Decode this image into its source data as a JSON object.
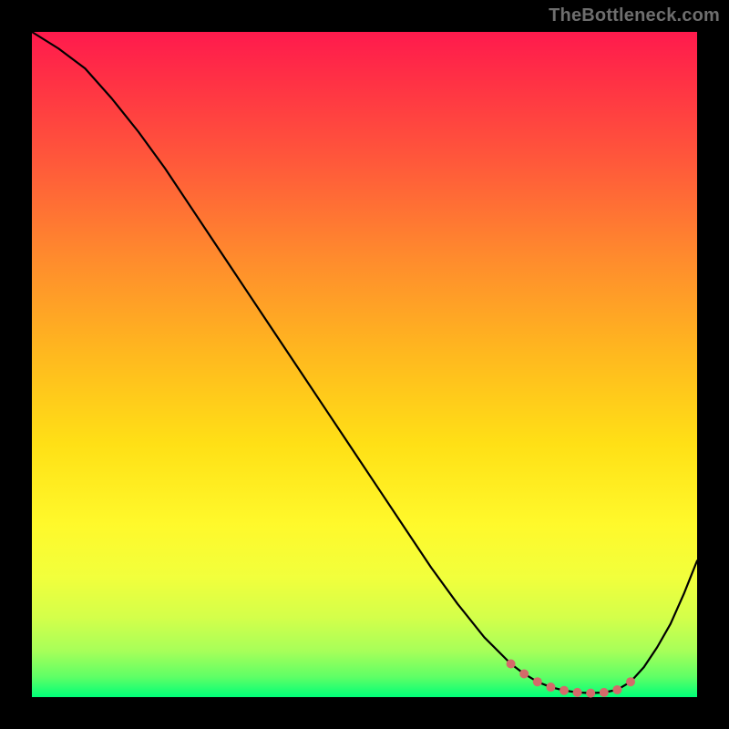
{
  "watermark": "TheBottleneck.com",
  "chart_data": {
    "type": "line",
    "title": "",
    "xlabel": "",
    "ylabel": "",
    "xlim": [
      0,
      100
    ],
    "ylim": [
      0,
      100
    ],
    "series": [
      {
        "name": "bottleneck-curve",
        "x": [
          0,
          4,
          8,
          12,
          16,
          20,
          24,
          28,
          32,
          36,
          40,
          44,
          48,
          52,
          56,
          60,
          64,
          68,
          72,
          74,
          76,
          78,
          80,
          82,
          84,
          86,
          88,
          90,
          92,
          94,
          96,
          98,
          100
        ],
        "y": [
          100,
          97.5,
          94.5,
          90.0,
          85.0,
          79.5,
          73.5,
          67.5,
          61.5,
          55.5,
          49.5,
          43.5,
          37.5,
          31.5,
          25.5,
          19.5,
          14.0,
          9.0,
          5.0,
          3.5,
          2.3,
          1.5,
          1.0,
          0.7,
          0.6,
          0.7,
          1.1,
          2.3,
          4.5,
          7.5,
          11.0,
          15.5,
          20.5
        ]
      }
    ],
    "markers": {
      "name": "flat-minimum-markers",
      "color": "#d46a6a",
      "radius": 5,
      "x": [
        72,
        74,
        76,
        78,
        80,
        82,
        84,
        86,
        88,
        90
      ],
      "y": [
        5.0,
        3.5,
        2.3,
        1.5,
        1.0,
        0.7,
        0.6,
        0.7,
        1.1,
        2.3
      ]
    },
    "background_gradient": {
      "top": "#ff1a4d",
      "mid_upper": "#ffb71f",
      "mid_lower": "#fff92b",
      "bottom": "#00ff78"
    }
  }
}
